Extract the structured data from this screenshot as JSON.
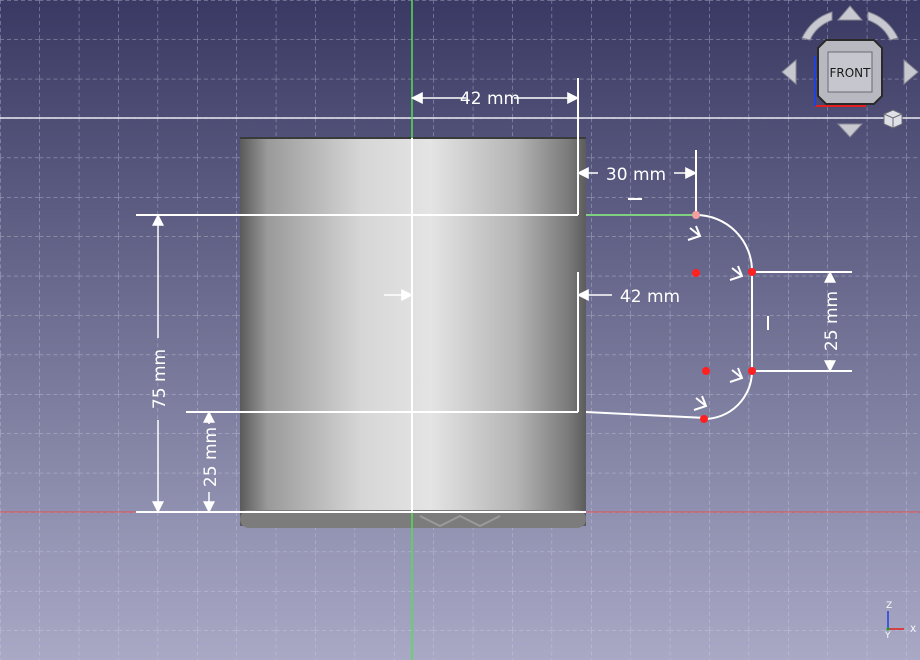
{
  "viewport": {
    "background_top": "#393963",
    "background_bottom": "#a9a9c6",
    "grid_color": "#c8c8dc",
    "x_axis_color": "#e05050",
    "y_axis_color": "#50e050"
  },
  "dimensions": {
    "radius_top": "42 mm",
    "handle_offset": "30 mm",
    "radius_inner": "42 mm",
    "height_total": "75 mm",
    "handle_bottom": "25 mm",
    "handle_height": "25 mm"
  },
  "nav_cube": {
    "face_label": "FRONT"
  },
  "axis_triad": {
    "x": "X",
    "y": "Y",
    "z": "Z"
  }
}
